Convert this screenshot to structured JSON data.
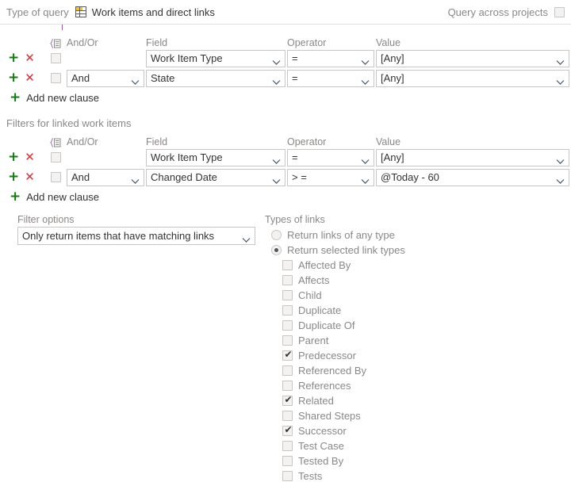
{
  "header": {
    "type_of_query_label": "Type of query",
    "query_type_value": "Work items and direct links",
    "query_type_icon": "grid-table-icon",
    "query_across_projects_label": "Query across projects",
    "query_across_projects_checked": false
  },
  "columns": {
    "group": "",
    "andor": "And/Or",
    "field": "Field",
    "operator": "Operator",
    "value": "Value"
  },
  "top_clauses": {
    "rows": [
      {
        "andor": "",
        "field": "Work Item Type",
        "operator": "=",
        "value": "[Any]",
        "grouped": false
      },
      {
        "andor": "And",
        "field": "State",
        "operator": "=",
        "value": "[Any]",
        "grouped": false
      }
    ],
    "add_new_clause_label": "Add new clause"
  },
  "linked_section": {
    "title": "Filters for linked work items",
    "rows": [
      {
        "andor": "",
        "field": "Work Item Type",
        "operator": "=",
        "value": "[Any]",
        "grouped": false
      },
      {
        "andor": "And",
        "field": "Changed Date",
        "operator": "> =",
        "value": "@Today - 60",
        "grouped": false
      }
    ],
    "add_new_clause_label": "Add new clause"
  },
  "filter_options": {
    "label": "Filter options",
    "selected": "Only return items that have matching links"
  },
  "types_of_links": {
    "label": "Types of links",
    "mode_options": [
      {
        "label": "Return links of any type",
        "selected": false
      },
      {
        "label": "Return selected link types",
        "selected": true
      }
    ],
    "link_types": [
      {
        "label": "Affected By",
        "checked": false
      },
      {
        "label": "Affects",
        "checked": false
      },
      {
        "label": "Child",
        "checked": false
      },
      {
        "label": "Duplicate",
        "checked": false
      },
      {
        "label": "Duplicate Of",
        "checked": false
      },
      {
        "label": "Parent",
        "checked": false
      },
      {
        "label": "Predecessor",
        "checked": true
      },
      {
        "label": "Referenced By",
        "checked": false
      },
      {
        "label": "References",
        "checked": false
      },
      {
        "label": "Related",
        "checked": true
      },
      {
        "label": "Shared Steps",
        "checked": false
      },
      {
        "label": "Successor",
        "checked": true
      },
      {
        "label": "Test Case",
        "checked": false
      },
      {
        "label": "Tested By",
        "checked": false
      },
      {
        "label": "Tests",
        "checked": false
      }
    ]
  },
  "colors": {
    "add": "#107c10",
    "remove": "#d13438",
    "label": "#8a8886",
    "border": "#c8c6c4"
  }
}
